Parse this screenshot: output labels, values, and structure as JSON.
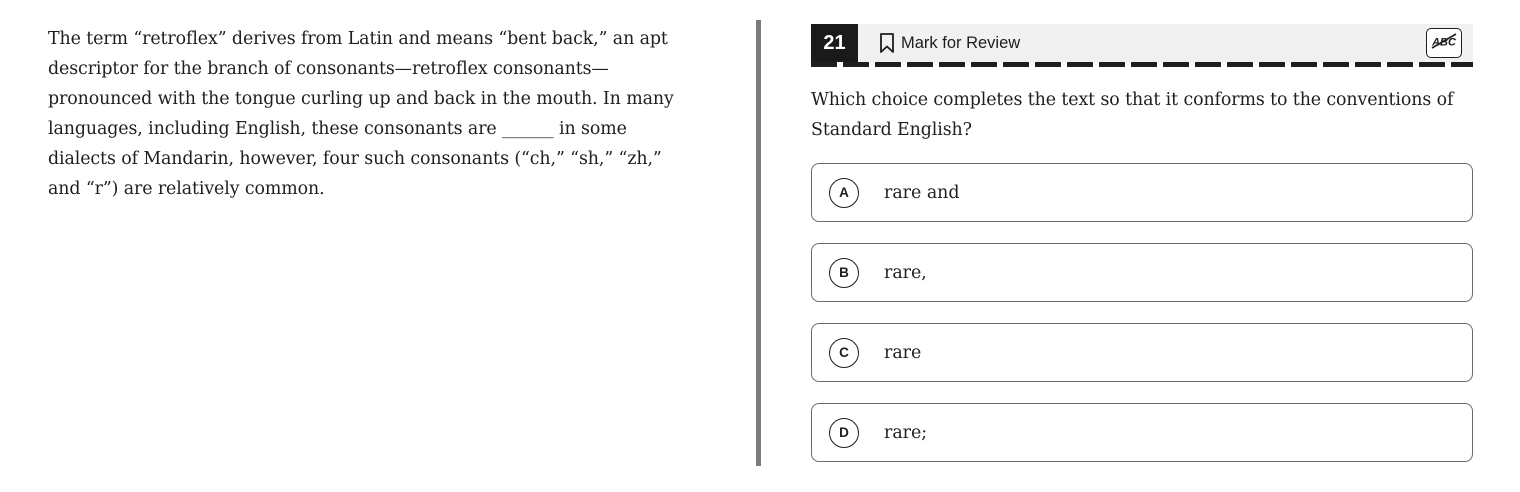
{
  "passage": {
    "text": "The term “retroflex” derives from Latin and means “bent back,” an apt descriptor for the branch of consonants—retroflex consonants—pronounced with the tongue curling up and back in the mouth. In many languages, including English, these consonants are ______ in some dialects of Mandarin, however, four such consonants (“ch,” “sh,” “zh,” and “r”) are relatively common."
  },
  "question": {
    "number": "21",
    "mark_for_review_label": "Mark for Review",
    "abc_label": "ABC",
    "prompt": "Which choice completes the text so that it conforms to the conventions of Standard English?",
    "choices": [
      {
        "letter": "A",
        "text": "rare and"
      },
      {
        "letter": "B",
        "text": "rare,"
      },
      {
        "letter": "C",
        "text": "rare"
      },
      {
        "letter": "D",
        "text": "rare;"
      }
    ]
  },
  "icons": {
    "mark_for_review": "bookmark-icon",
    "eliminator": "abc-strikethrough-icon"
  },
  "colors": {
    "question_number_bg": "#1a1a1a",
    "header_bg": "#f1f1f1",
    "divider": "#7b7b7b",
    "text": "#1e1e1e"
  }
}
